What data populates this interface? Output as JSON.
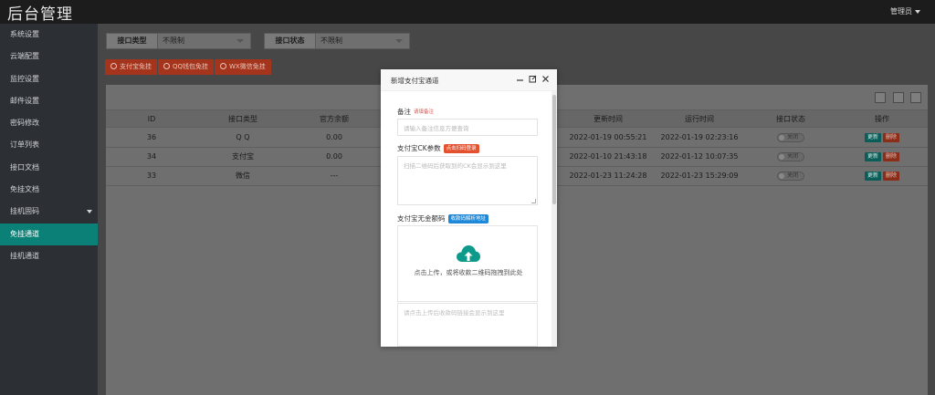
{
  "header": {
    "title": "后台管理",
    "user": "管理员"
  },
  "sidebar": {
    "items": [
      {
        "label": "系统设置"
      },
      {
        "label": "云端配置"
      },
      {
        "label": "监控设置"
      },
      {
        "label": "邮件设置"
      },
      {
        "label": "密码修改"
      },
      {
        "label": "订单列表"
      },
      {
        "label": "接口文档"
      },
      {
        "label": "免挂文档"
      },
      {
        "label": "挂机固码"
      },
      {
        "label": "免挂通道"
      },
      {
        "label": "挂机通道"
      }
    ],
    "active_index": 9
  },
  "filters": {
    "type": {
      "label": "接口类型",
      "value": "不限制"
    },
    "status": {
      "label": "接口状态",
      "value": "不限制"
    }
  },
  "actions": {
    "alipay": "支付宝免挂",
    "qq": "QQ钱包免挂",
    "wx": "WX微信免挂"
  },
  "table": {
    "columns": [
      "ID",
      "接口类型",
      "官方余额",
      "更新时间",
      "运行时间",
      "接口状态",
      "操作"
    ],
    "rows": [
      {
        "id": "36",
        "type": "Q Q",
        "balance": "0.00",
        "updated": "2022-01-19 00:55:21",
        "runtime": "2022-01-19 02:23:16",
        "status": "关闭",
        "update": "更新",
        "delete": "删除"
      },
      {
        "id": "34",
        "type": "支付宝",
        "balance": "0.00",
        "updated": "2022-01-10 21:43:18",
        "runtime": "2022-01-12 10:07:35",
        "status": "关闭",
        "update": "更新",
        "delete": "删除"
      },
      {
        "id": "33",
        "type": "微信",
        "balance": "---",
        "updated": "2022-01-23 11:24:28",
        "runtime": "2022-01-23 15:29:09",
        "status": "关闭",
        "update": "更新",
        "delete": "删除"
      }
    ]
  },
  "modal": {
    "title": "新增支付宝通道",
    "remark_label": "备注",
    "remark_hint": "请填备注",
    "remark_placeholder": "请输入备注信息方便查询",
    "ck_label": "支付宝CK参数",
    "ck_button": "点击扫码登录",
    "ck_placeholder": "扫描二维码后获取到的CK会显示到这里",
    "qr_label": "支付宝无金额码",
    "qr_tag": "收款码解析地址",
    "upload_text": "点击上传，或将收款二维码拖拽到此处",
    "link_placeholder": "请点击上传后收款码链接会显示到这里"
  },
  "colors": {
    "accent": "#0a8077",
    "danger": "#e4512f",
    "info": "#1e88d9",
    "upload_icon": "#0e9a8a"
  }
}
